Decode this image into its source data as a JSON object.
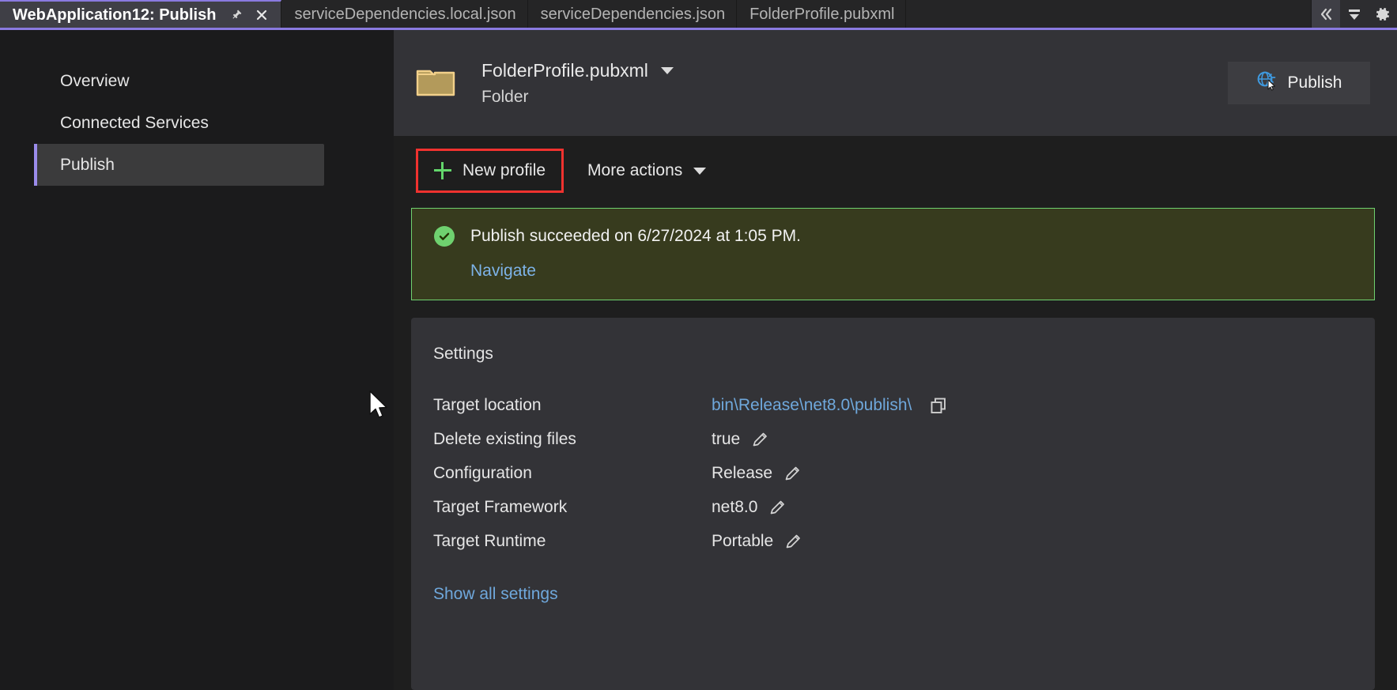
{
  "tabs": [
    {
      "label": "WebApplication12: Publish",
      "active": true,
      "pin_icon": "pin-icon",
      "close_icon": "close-icon"
    },
    {
      "label": "serviceDependencies.local.json",
      "active": false
    },
    {
      "label": "serviceDependencies.json",
      "active": false
    },
    {
      "label": "FolderProfile.pubxml",
      "active": false
    }
  ],
  "tabstrip_actions": [
    {
      "name": "collapse-icon",
      "glyph": "«"
    },
    {
      "name": "tab-list-icon",
      "glyph": "▼"
    },
    {
      "name": "settings-gear-icon",
      "glyph": "⚙"
    }
  ],
  "sidebar": {
    "items": [
      {
        "label": "Overview",
        "selected": false
      },
      {
        "label": "Connected Services",
        "selected": false
      },
      {
        "label": "Publish",
        "selected": true
      }
    ]
  },
  "profile_header": {
    "icon": "folder-icon",
    "name": "FolderProfile.pubxml",
    "type": "Folder",
    "dropdown_icon": "chevron-down-icon",
    "publish_button": {
      "label": "Publish",
      "icon": "publish-globe-icon"
    }
  },
  "toolbar": {
    "new_profile_label": "New profile",
    "new_profile_icon": "plus-icon",
    "more_actions_label": "More actions",
    "more_actions_icon": "chevron-down-icon"
  },
  "banner": {
    "status_icon": "success-check-icon",
    "message": "Publish succeeded on 6/27/2024 at 1:05 PM.",
    "link_label": "Navigate",
    "border_color": "#6fd16f",
    "background_color": "#373b1e"
  },
  "settings": {
    "title": "Settings",
    "rows": [
      {
        "label": "Target location",
        "value": "bin\\Release\\net8.0\\publish\\",
        "action_icon": "copy-icon",
        "is_link": true
      },
      {
        "label": "Delete existing files",
        "value": "true",
        "action_icon": "pencil-icon",
        "is_link": false
      },
      {
        "label": "Configuration",
        "value": "Release",
        "action_icon": "pencil-icon",
        "is_link": false
      },
      {
        "label": "Target Framework",
        "value": "net8.0",
        "action_icon": "pencil-icon",
        "is_link": false
      },
      {
        "label": "Target Runtime",
        "value": "Portable",
        "action_icon": "pencil-icon",
        "is_link": false
      }
    ],
    "show_all_label": "Show all settings"
  },
  "colors": {
    "accent_purple": "#8a7ae0",
    "link_blue": "#6fa8dc",
    "success_green": "#6fd16f",
    "highlight_red": "#f0322f",
    "plus_green": "#63d66b"
  }
}
